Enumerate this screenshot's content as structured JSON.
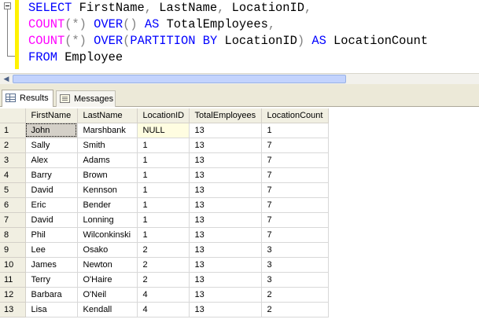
{
  "editor": {
    "lines": [
      [
        {
          "t": "SELECT",
          "c": "kw"
        },
        {
          "t": " FirstName",
          "c": "tx"
        },
        {
          "t": ",",
          "c": "op"
        },
        {
          "t": " LastName",
          "c": "tx"
        },
        {
          "t": ",",
          "c": "op"
        },
        {
          "t": " LocationID",
          "c": "tx"
        },
        {
          "t": ",",
          "c": "op"
        }
      ],
      [
        {
          "t": "COUNT",
          "c": "fn"
        },
        {
          "t": "(*)",
          "c": "op"
        },
        {
          "t": " ",
          "c": "tx"
        },
        {
          "t": "OVER",
          "c": "kw"
        },
        {
          "t": "()",
          "c": "op"
        },
        {
          "t": " ",
          "c": "tx"
        },
        {
          "t": "AS",
          "c": "kw"
        },
        {
          "t": " TotalEmployees",
          "c": "tx"
        },
        {
          "t": ",",
          "c": "op"
        }
      ],
      [
        {
          "t": "COUNT",
          "c": "fn"
        },
        {
          "t": "(*)",
          "c": "op"
        },
        {
          "t": " ",
          "c": "tx"
        },
        {
          "t": "OVER",
          "c": "kw"
        },
        {
          "t": "(",
          "c": "op"
        },
        {
          "t": "PARTITION",
          "c": "kw"
        },
        {
          "t": " ",
          "c": "tx"
        },
        {
          "t": "BY",
          "c": "kw"
        },
        {
          "t": " LocationID",
          "c": "tx"
        },
        {
          "t": ")",
          "c": "op"
        },
        {
          "t": " ",
          "c": "tx"
        },
        {
          "t": "AS",
          "c": "kw"
        },
        {
          "t": " LocationCount",
          "c": "tx"
        }
      ],
      [
        {
          "t": "FROM",
          "c": "kw"
        },
        {
          "t": " Employee",
          "c": "tx"
        }
      ]
    ],
    "colors": {
      "keyword": "#0000ff",
      "function": "#ff00ff",
      "operator": "#808080",
      "text": "#000000",
      "change_bar": "#fff200"
    }
  },
  "tabs": [
    {
      "label": "Results",
      "icon": "results-grid-icon",
      "active": true
    },
    {
      "label": "Messages",
      "icon": "messages-icon",
      "active": false
    }
  ],
  "results": {
    "columns": [
      "FirstName",
      "LastName",
      "LocationID",
      "TotalEmployees",
      "LocationCount"
    ],
    "rows": [
      [
        "1",
        "John",
        "Marshbank",
        "NULL",
        "13",
        "1"
      ],
      [
        "2",
        "Sally",
        "Smith",
        "1",
        "13",
        "7"
      ],
      [
        "3",
        "Alex",
        "Adams",
        "1",
        "13",
        "7"
      ],
      [
        "4",
        "Barry",
        "Brown",
        "1",
        "13",
        "7"
      ],
      [
        "5",
        "David",
        "Kennson",
        "1",
        "13",
        "7"
      ],
      [
        "6",
        "Eric",
        "Bender",
        "1",
        "13",
        "7"
      ],
      [
        "7",
        "David",
        "Lonning",
        "1",
        "13",
        "7"
      ],
      [
        "8",
        "Phil",
        "Wilconkinski",
        "1",
        "13",
        "7"
      ],
      [
        "9",
        "Lee",
        "Osako",
        "2",
        "13",
        "3"
      ],
      [
        "10",
        "James",
        "Newton",
        "2",
        "13",
        "3"
      ],
      [
        "11",
        "Terry",
        "O'Haire",
        "2",
        "13",
        "3"
      ],
      [
        "12",
        "Barbara",
        "O'Neil",
        "4",
        "13",
        "2"
      ],
      [
        "13",
        "Lisa",
        "Kendall",
        "4",
        "13",
        "2"
      ]
    ]
  }
}
